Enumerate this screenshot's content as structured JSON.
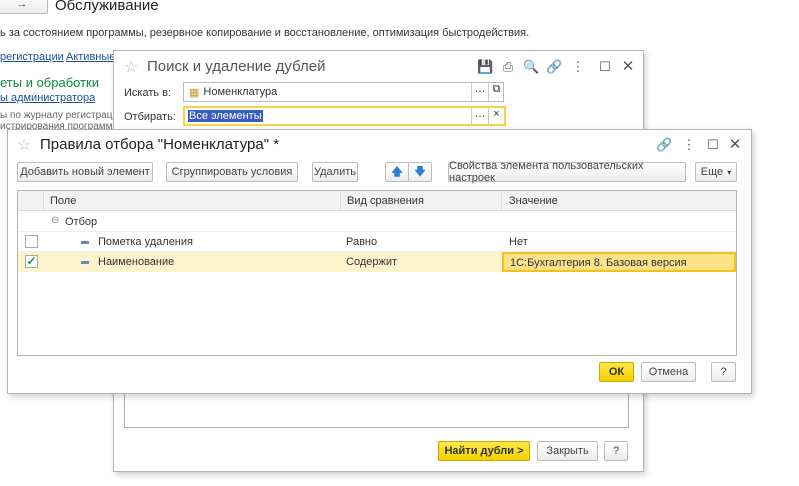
{
  "background": {
    "title": "Обслуживание",
    "description": "ь за состоянием программы, резервное копирование и восстановление, оптимизация быстродействия.",
    "links": [
      "регистрации",
      "Активные п"
    ],
    "section": "еты и обработки",
    "section_link": "ы администратора",
    "text1": "ы по журналу регистрации",
    "text2": "истрирования программы"
  },
  "search_dialog": {
    "title": "Поиск и удаление дублей",
    "search_in_label": "Искать в:",
    "search_in_value": "Номенклатура",
    "filter_label": "Отбирать:",
    "filter_value": "Все элементы",
    "find_button": "Найти дубли >",
    "close_button": "Закрыть",
    "help_button": "?"
  },
  "rules_dialog": {
    "title": "Правила отбора \"Номенклатура\" *",
    "toolbar": {
      "add": "Добавить новый элемент",
      "group": "Сгруппировать условия",
      "delete": "Удалить",
      "properties": "Свойства элемента пользовательских настроек",
      "more": "Еще"
    },
    "columns": [
      "Поле",
      "Вид сравнения",
      "Значение"
    ],
    "group_row": "Отбор",
    "rows": [
      {
        "checked": false,
        "field": "Пометка удаления",
        "comparison": "Равно",
        "value": "Нет"
      },
      {
        "checked": true,
        "field": "Наименование",
        "comparison": "Содержит",
        "value": "1С:Бухгалтерия 8. Базовая версия"
      }
    ],
    "ok": "ОК",
    "cancel": "Отмена",
    "help": "?"
  },
  "colors": {
    "accent_yellow": "#f5d90a",
    "selected_row": "#fdf3cc",
    "link": "#1a4f9c",
    "green": "#0f8a3c"
  }
}
